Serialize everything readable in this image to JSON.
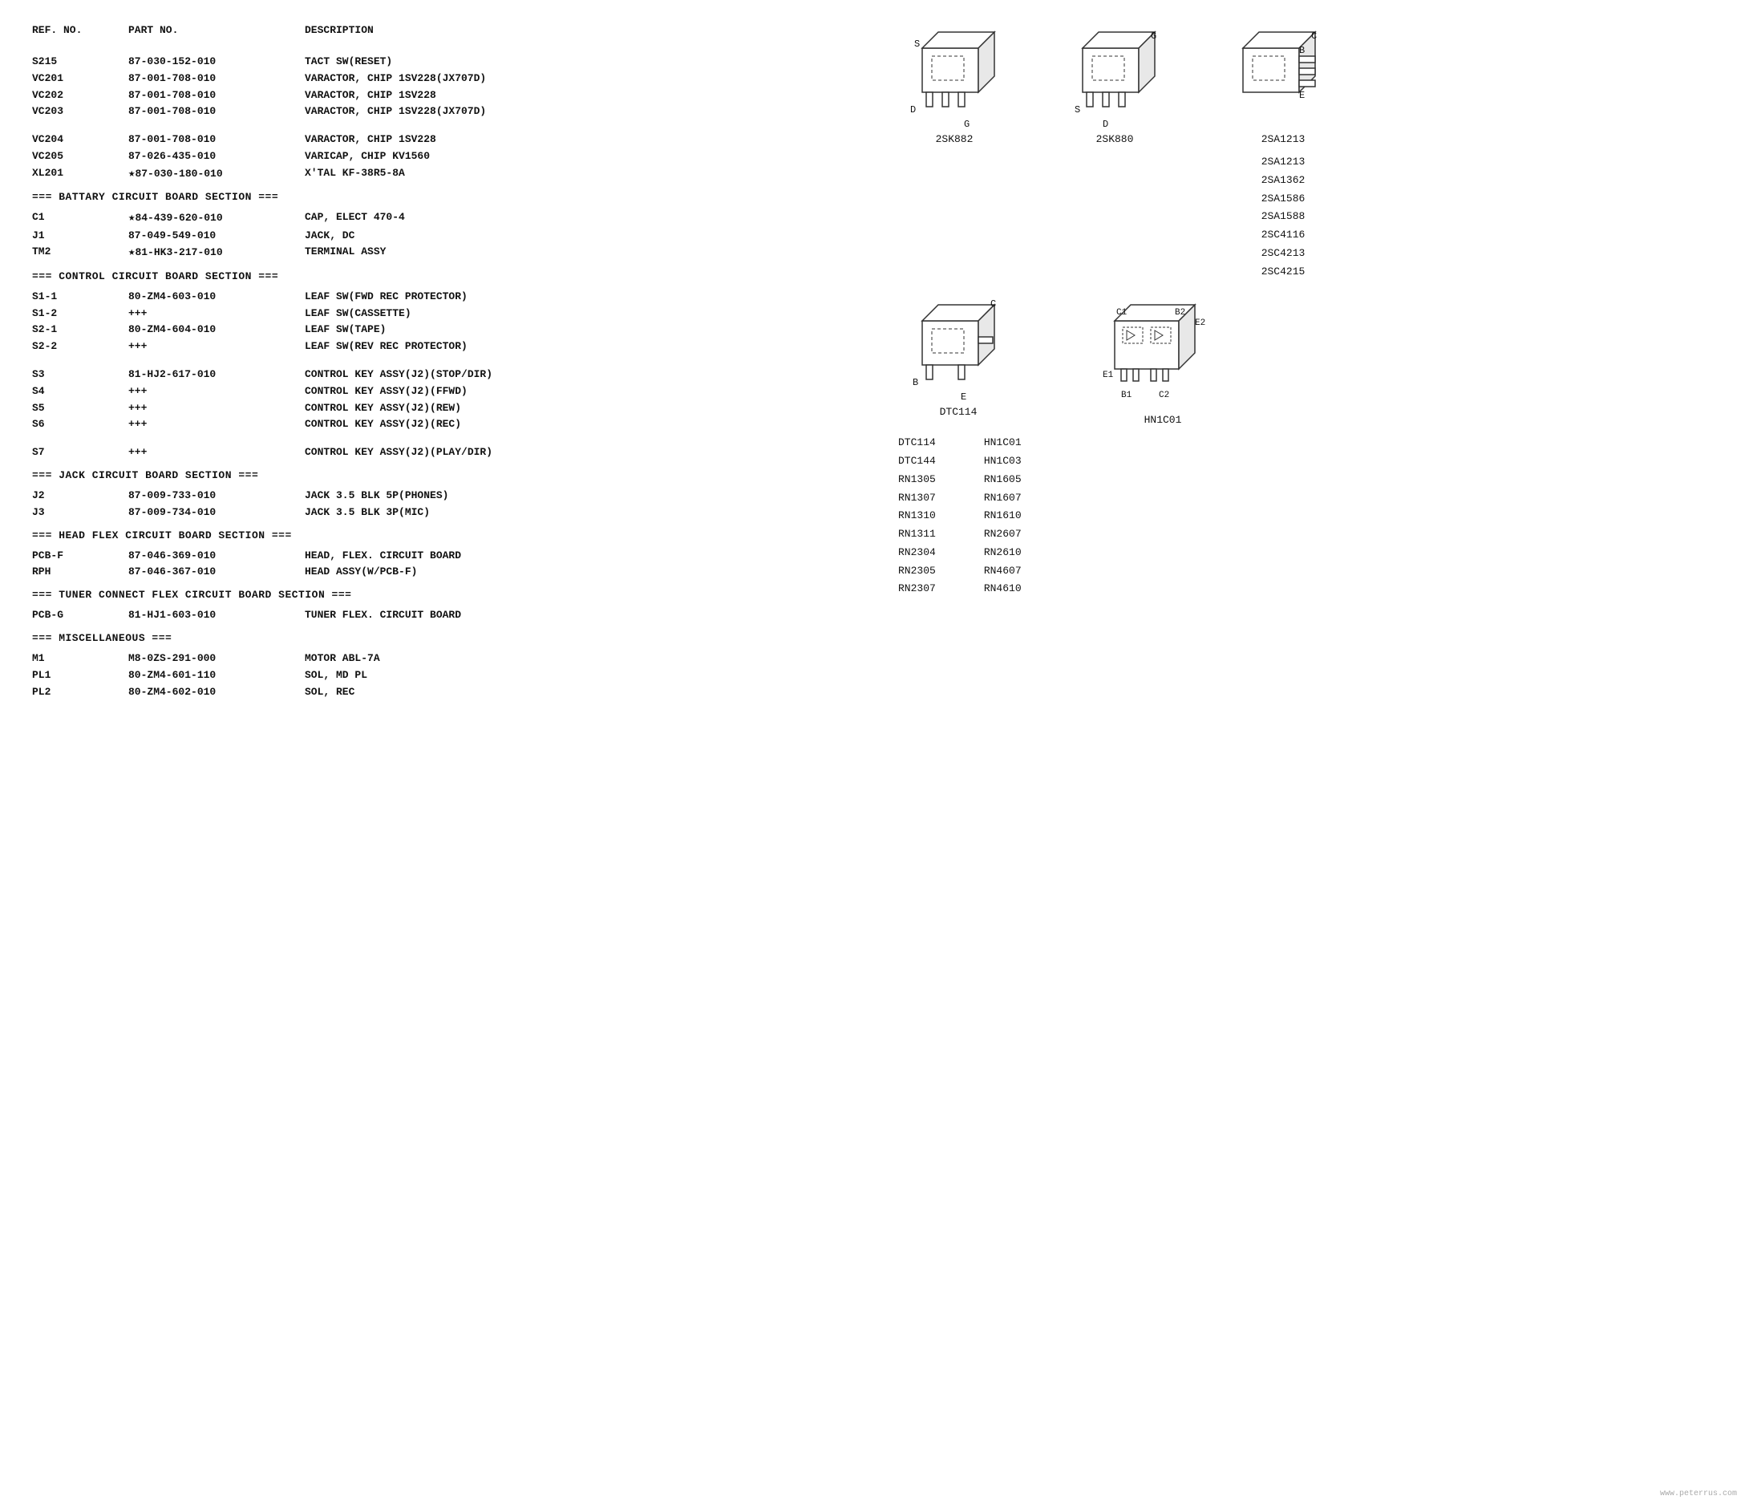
{
  "header": {
    "col_ref": "REF. NO.",
    "col_part": "PART NO.",
    "col_desc": "DESCRIPTION"
  },
  "sections": [
    {
      "id": "top",
      "header": null,
      "parts": [
        {
          "ref": "S215",
          "part": "87-030-152-010",
          "desc": "TACT SW(RESET)",
          "star": false
        },
        {
          "ref": "VC201",
          "part": "87-001-708-010",
          "desc": "VARACTOR, CHIP 1SV228(JX707D)",
          "star": false
        },
        {
          "ref": "VC202",
          "part": "87-001-708-010",
          "desc": "VARACTOR, CHIP 1SV228",
          "star": false
        },
        {
          "ref": "VC203",
          "part": "87-001-708-010",
          "desc": "VARACTOR, CHIP 1SV228(JX707D)",
          "star": false
        }
      ]
    },
    {
      "id": "top2",
      "header": null,
      "parts": [
        {
          "ref": "VC204",
          "part": "87-001-708-010",
          "desc": "VARACTOR, CHIP 1SV228",
          "star": false
        },
        {
          "ref": "VC205",
          "part": "87-026-435-010",
          "desc": "VARICAP, CHIP KV1560",
          "star": false
        },
        {
          "ref": "XL201",
          "part": "87-030-180-010",
          "desc": "X'TAL KF-38R5-8A",
          "star": true
        }
      ]
    },
    {
      "id": "battery",
      "header": "=== BATTARY CIRCUIT BOARD SECTION ===",
      "parts": [
        {
          "ref": "C1",
          "part": "84-439-620-010",
          "desc": "CAP, ELECT 470-4",
          "star": true
        },
        {
          "ref": "J1",
          "part": "87-049-549-010",
          "desc": "JACK, DC",
          "star": false
        },
        {
          "ref": "TM2",
          "part": "81-HK3-217-010",
          "desc": "TERMINAL ASSY",
          "star": true
        }
      ]
    },
    {
      "id": "control",
      "header": "=== CONTROL CIRCUIT BOARD SECTION ===",
      "parts": [
        {
          "ref": "S1-1",
          "part": "80-ZM4-603-010",
          "desc": "LEAF SW(FWD REC PROTECTOR)",
          "star": false
        },
        {
          "ref": "S1-2",
          "part": "+++",
          "desc": "LEAF SW(CASSETTE)",
          "star": false
        },
        {
          "ref": "S2-1",
          "part": "80-ZM4-604-010",
          "desc": "LEAF SW(TAPE)",
          "star": false
        },
        {
          "ref": "S2-2",
          "part": "+++",
          "desc": "LEAF SW(REV REC PROTECTOR)",
          "star": false
        }
      ]
    },
    {
      "id": "control2",
      "header": null,
      "parts": [
        {
          "ref": "S3",
          "part": "81-HJ2-617-010",
          "desc": "CONTROL KEY ASSY(J2)(STOP/DIR)",
          "star": false
        },
        {
          "ref": "S4",
          "part": "+++",
          "desc": "CONTROL KEY ASSY(J2)(FFWD)",
          "star": false
        },
        {
          "ref": "S5",
          "part": "+++",
          "desc": "CONTROL KEY ASSY(J2)(REW)",
          "star": false
        },
        {
          "ref": "S6",
          "part": "+++",
          "desc": "CONTROL KEY ASSY(J2)(REC)",
          "star": false
        }
      ]
    },
    {
      "id": "control3",
      "header": null,
      "parts": [
        {
          "ref": "S7",
          "part": "+++",
          "desc": "CONTROL KEY ASSY(J2)(PLAY/DIR)",
          "star": false
        }
      ]
    },
    {
      "id": "jack",
      "header": "=== JACK CIRCUIT BOARD SECTION ===",
      "parts": [
        {
          "ref": "J2",
          "part": "87-009-733-010",
          "desc": "JACK 3.5 BLK 5P(PHONES)",
          "star": false
        },
        {
          "ref": "J3",
          "part": "87-009-734-010",
          "desc": "JACK 3.5 BLK 3P(MIC)",
          "star": false
        }
      ]
    },
    {
      "id": "headflex",
      "header": "=== HEAD FLEX CIRCUIT BOARD SECTION ===",
      "parts": [
        {
          "ref": "PCB-F",
          "part": "87-046-369-010",
          "desc": "HEAD, FLEX. CIRCUIT BOARD",
          "star": false
        },
        {
          "ref": "RPH",
          "part": "87-046-367-010",
          "desc": "HEAD ASSY(W/PCB-F)",
          "star": false
        }
      ]
    },
    {
      "id": "tuner",
      "header": "=== TUNER CONNECT FLEX CIRCUIT BOARD SECTION ===",
      "parts": [
        {
          "ref": "PCB-G",
          "part": "81-HJ1-603-010",
          "desc": "TUNER FLEX. CIRCUIT BOARD",
          "star": false
        }
      ]
    },
    {
      "id": "misc",
      "header": "=== MISCELLANEOUS ===",
      "parts": [
        {
          "ref": "M1",
          "part": "M8-0ZS-291-000",
          "desc": "MOTOR ABL-7A",
          "star": false
        },
        {
          "ref": "PL1",
          "part": "80-ZM4-601-110",
          "desc": "SOL, MD PL",
          "star": false
        },
        {
          "ref": "PL2",
          "part": "80-ZM4-602-010",
          "desc": "SOL, REC",
          "star": false
        }
      ]
    }
  ],
  "diagrams": {
    "top_row": [
      {
        "label": "2SK882",
        "pin_labels": [
          "S",
          "D",
          "G"
        ],
        "type": "3pin_left"
      },
      {
        "label": "2SK880",
        "pin_labels": [
          "G",
          "S",
          "D"
        ],
        "type": "3pin_left"
      },
      {
        "label": "2SA1213",
        "pin_labels": [
          "C",
          "B",
          "E"
        ],
        "type": "3pin_right"
      }
    ],
    "component_list": [
      "2SA1213",
      "2SA1362",
      "2SA1586",
      "2SA1588",
      "2SC4116",
      "2SC4213",
      "2SC4215"
    ],
    "bottom_row": [
      {
        "label": "DTC114",
        "pin_labels": [
          "B",
          "C",
          "E"
        ],
        "type": "3pin_left_single"
      },
      {
        "label": "HN1C01",
        "pin_labels": [
          "C1",
          "B2",
          "E2",
          "E1",
          "B1",
          "C2"
        ],
        "type": "6pin"
      }
    ],
    "bottom_left_list": [
      "DTC114",
      "DTC144",
      "RN1305",
      "RN1307",
      "RN1310",
      "RN1311",
      "RN2304",
      "RN2305",
      "RN2307"
    ],
    "bottom_right_list": [
      "HN1C01",
      "HN1C03",
      "RN1605",
      "RN1607",
      "RN1610",
      "RN2607",
      "RN2610",
      "RN4607",
      "RN4610"
    ]
  },
  "watermark": "www.peterrus.com"
}
